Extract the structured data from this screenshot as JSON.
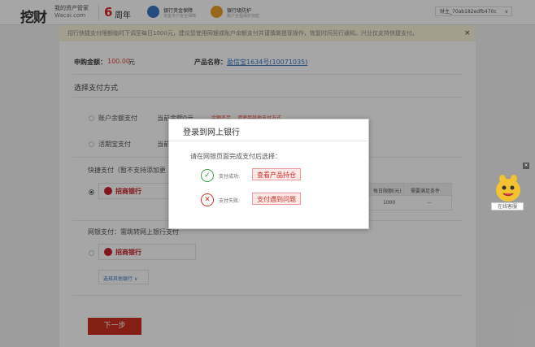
{
  "header": {
    "logo": "挖财",
    "logo_tagline": "我的资产管家",
    "logo_domain": "Wacai.com",
    "anniversary_number": "6",
    "anniversary_label": "周年",
    "trust_items": [
      {
        "title": "银行资金保障",
        "subtitle": "资金专户安全保障",
        "icon": "shield-icon",
        "color": "#3a73c3"
      },
      {
        "title": "银行级防护",
        "subtitle": "账户全程保护加密",
        "icon": "umbrella-icon",
        "color": "#e8a02a"
      }
    ],
    "account_label": "财主_70ab182edfb470c"
  },
  "notice": {
    "text": "招行快捷支付限额临时下调至每日1000元，建议您使用网银或账户余额支付并谨慎做提现操作，恢复时间另行通知。兴业仅支持快捷支付。",
    "close": "×"
  },
  "order": {
    "amount_label": "申购金额：",
    "amount_value": "100.00",
    "amount_unit": "元",
    "product_label": "产品名称：",
    "product_value": "盈信宝1634号(10071035)"
  },
  "payment": {
    "section_title": "选择支付方式",
    "balance_label": "账户余额支付",
    "balance_available": "当前余额0元",
    "balance_hint": "余额不足",
    "balance_hint2": "请使用其他支付方式",
    "huoqi_label": "活期宝支付",
    "huoqi_available": "当前",
    "quick_title": "快捷支付（暂不支持添加更",
    "quick_bank": "招商银行",
    "table_headers": [
      "每日限额(元)",
      "需要满足条件"
    ],
    "table_values": [
      "1000",
      "--"
    ],
    "netbank_title": "网银支付：需跳转网上银行支付",
    "netbank_bank": "招商银行",
    "select_other": "选择其他银行 ∨",
    "next_button": "下一步"
  },
  "modal": {
    "title": "登录到网上银行",
    "prompt": "请在网银页面完成支付后选择：",
    "success_label": "支付成功:",
    "success_button": "查看产品持仓",
    "fail_label": "支付失败:",
    "fail_button": "支付遇到问题"
  },
  "service": {
    "label": "在线客服",
    "close": "×"
  }
}
